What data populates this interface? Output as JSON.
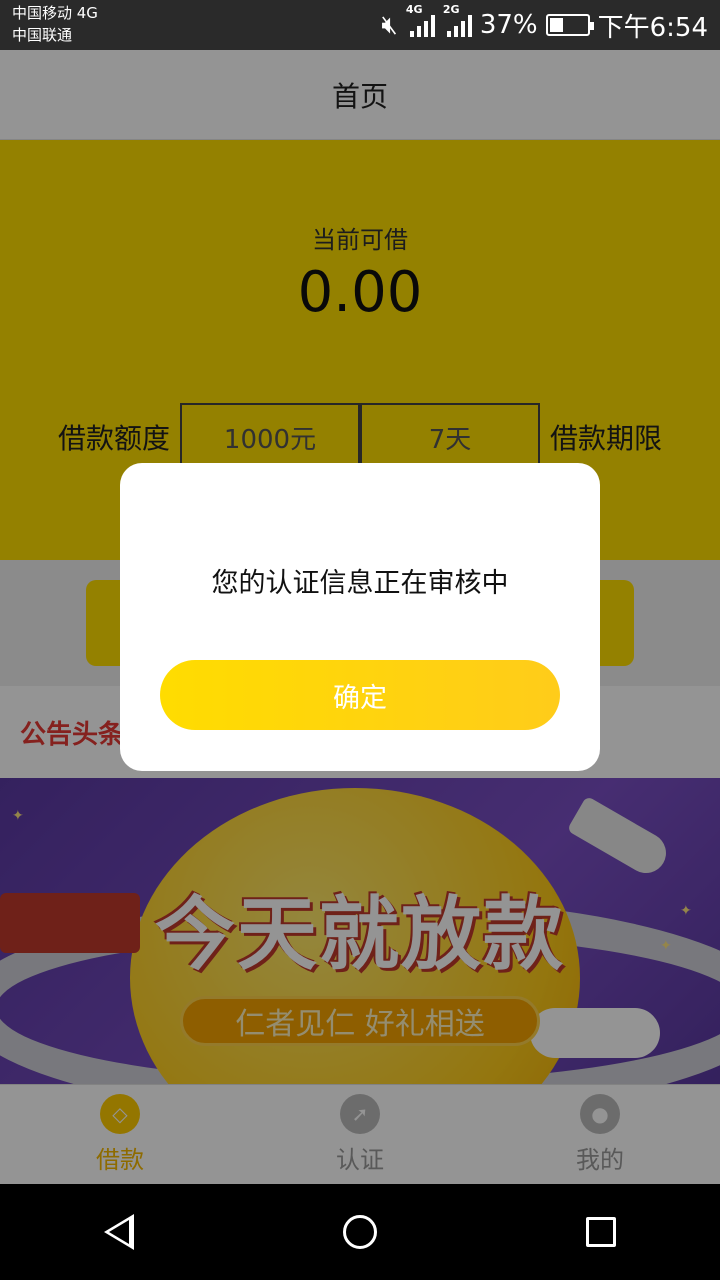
{
  "status_bar": {
    "carrier1": "中国移动 4G",
    "carrier2": "中国联通",
    "net1": "4G",
    "net2": "2G",
    "battery": "37%",
    "battery_level": 0.37,
    "time": "下午6:54"
  },
  "header": {
    "title": "首页"
  },
  "hero": {
    "label": "当前可借",
    "amount": "0.00",
    "loan_limit_label": "借款额度",
    "loan_amount": "1000元",
    "loan_days": "7天",
    "loan_period_label": "借款期限"
  },
  "notice": {
    "title": "公告头条"
  },
  "banner": {
    "headline": "今天就放款",
    "slogan": "仁者见仁  好礼相送"
  },
  "tabs": [
    {
      "label": "借款",
      "icon": "loan-icon",
      "active": true
    },
    {
      "label": "认证",
      "icon": "verify-icon",
      "active": false
    },
    {
      "label": "我的",
      "icon": "profile-icon",
      "active": false
    }
  ],
  "dialog": {
    "message": "您的认证信息正在审核中",
    "confirm": "确定"
  },
  "colors": {
    "accent": "#ffde00",
    "notice_red": "#e53935",
    "active_tab": "#f5b800"
  }
}
